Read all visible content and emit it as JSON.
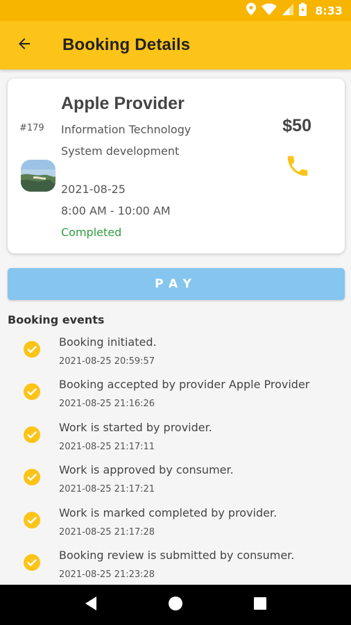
{
  "status_bar": {
    "time": "8:33",
    "icons": [
      "location-icon",
      "wifi-icon",
      "signal-icon",
      "battery-icon"
    ]
  },
  "app_bar": {
    "title": "Booking Details",
    "back_icon": "arrow-back-icon"
  },
  "booking": {
    "id": "#179",
    "provider": "Apple Provider",
    "category": "Information Technology",
    "service": "System development",
    "date": "2021-08-25",
    "time": "8:00 AM - 10:00 AM",
    "status": "Completed",
    "price": "$50",
    "phone_icon": "phone-icon",
    "status_color": "#2e9e3e"
  },
  "pay_button": {
    "label": "PAY",
    "color": "#86c5ee"
  },
  "events_title": "Booking events",
  "events": [
    {
      "text": "Booking initiated.",
      "timestamp": "2021-08-25 20:59:57"
    },
    {
      "text": "Booking accepted by provider Apple Provider",
      "timestamp": "2021-08-25 21:16:26"
    },
    {
      "text": "Work is started by provider.",
      "timestamp": "2021-08-25 21:17:11"
    },
    {
      "text": "Work is approved by consumer.",
      "timestamp": "2021-08-25 21:17:21"
    },
    {
      "text": "Work is marked completed by provider.",
      "timestamp": "2021-08-25 21:17:28"
    },
    {
      "text": "Booking review is submitted by consumer.",
      "timestamp": "2021-08-25 21:23:28"
    }
  ],
  "theme": {
    "accent": "#fcc419",
    "status_bar": "#f7b500",
    "check_color": "#fcc419"
  },
  "nav_bar": {
    "icons": [
      "back-triangle-icon",
      "home-circle-icon",
      "recents-square-icon"
    ]
  }
}
